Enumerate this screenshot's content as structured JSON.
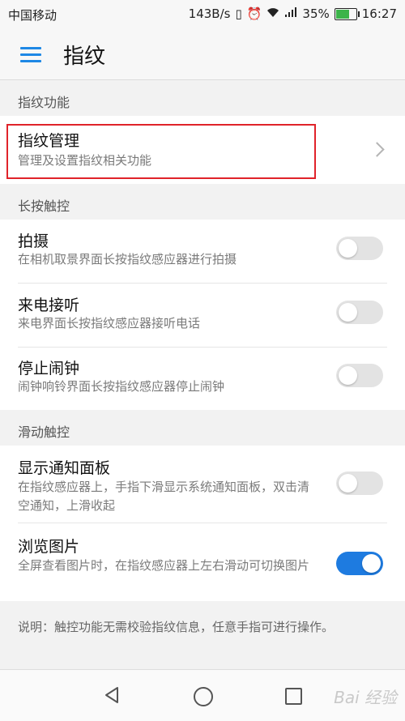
{
  "status_bar": {
    "carrier": "中国移动",
    "speed": "143B/s",
    "battery_percent": "35%",
    "time": "16:27"
  },
  "header": {
    "title": "指纹",
    "accent_color": "#1e88e5"
  },
  "sections": [
    {
      "header": "指纹功能",
      "items": [
        {
          "title": "指纹管理",
          "subtitle": "管理及设置指纹相关功能",
          "control": "chevron"
        }
      ]
    },
    {
      "header": "长按触控",
      "items": [
        {
          "title": "拍摄",
          "subtitle": "在相机取景界面长按指纹感应器进行拍摄",
          "control": "toggle",
          "enabled": false
        },
        {
          "title": "来电接听",
          "subtitle": "来电界面长按指纹感应器接听电话",
          "control": "toggle",
          "enabled": false
        },
        {
          "title": "停止闹钟",
          "subtitle": "闹钟响铃界面长按指纹感应器停止闹钟",
          "control": "toggle",
          "enabled": false
        }
      ]
    },
    {
      "header": "滑动触控",
      "items": [
        {
          "title": "显示通知面板",
          "subtitle": "在指纹感应器上，手指下滑显示系统通知面板，双击清空通知，上滑收起",
          "control": "toggle",
          "enabled": false
        },
        {
          "title": "浏览图片",
          "subtitle": "全屏查看图片时，在指纹感应器上左右滑动可切换图片",
          "control": "toggle",
          "enabled": true
        }
      ]
    }
  ],
  "note": "说明：触控功能无需校验指纹信息，任意手指可进行操作。",
  "nav_bar": {
    "icons": [
      "back-icon",
      "home-icon",
      "recent-apps-icon"
    ],
    "watermark": "Bai 经验"
  }
}
